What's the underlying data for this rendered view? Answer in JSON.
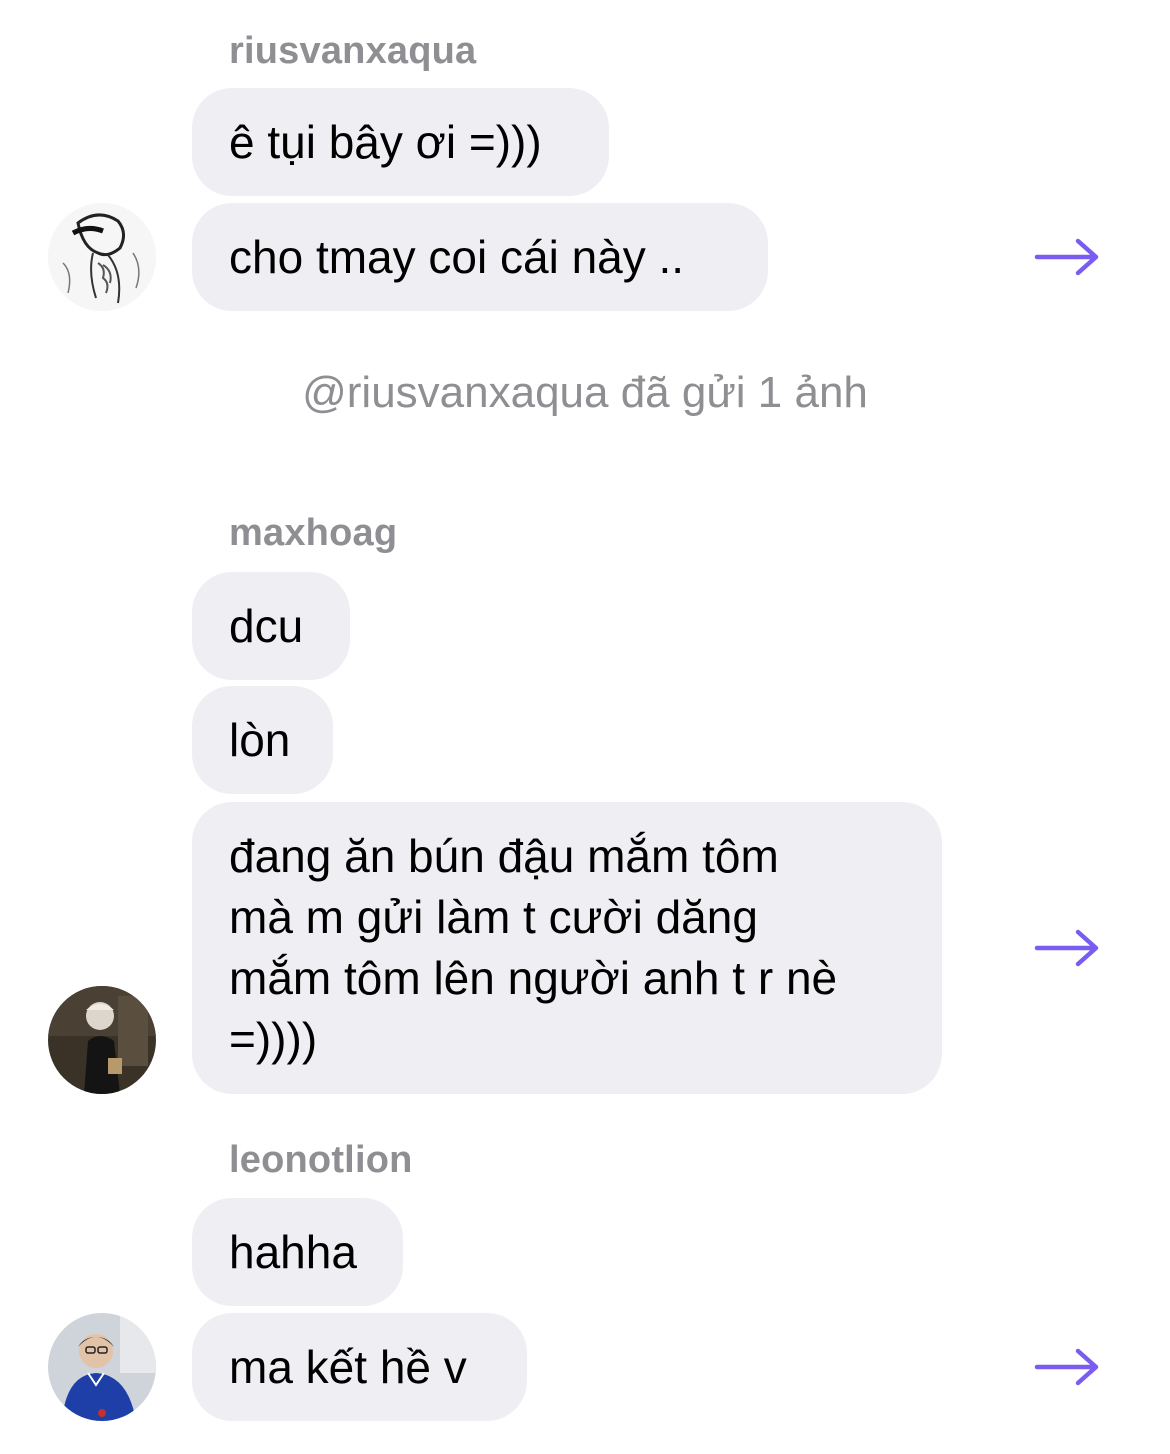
{
  "groups": [
    {
      "sender": "riusvanxaqua",
      "messages": [
        "ê tụi bây ơi =)))",
        "cho tmay coi cái này .."
      ],
      "avatar_icon": "sketch-avatar-icon"
    },
    {
      "sender": "maxhoag",
      "messages": [
        "dcu",
        "lòn",
        "đang ăn bún đậu mắm tôm\nmà m gửi làm t cười dăng\nmắm tôm lên người anh t r nè\n=))))"
      ],
      "avatar_icon": "photo-avatar-icon"
    },
    {
      "sender": "leonotlion",
      "messages": [
        "hahha",
        "ma kết hề v"
      ],
      "avatar_icon": "photo-avatar-icon"
    }
  ],
  "system_message": "@riusvanxaqua đã gửi 1 ảnh",
  "share_icon": "arrow-right-icon",
  "colors": {
    "bubble": "#efeff3",
    "secondary_text": "#8e8e93",
    "arrow": "#7b5cf0"
  }
}
